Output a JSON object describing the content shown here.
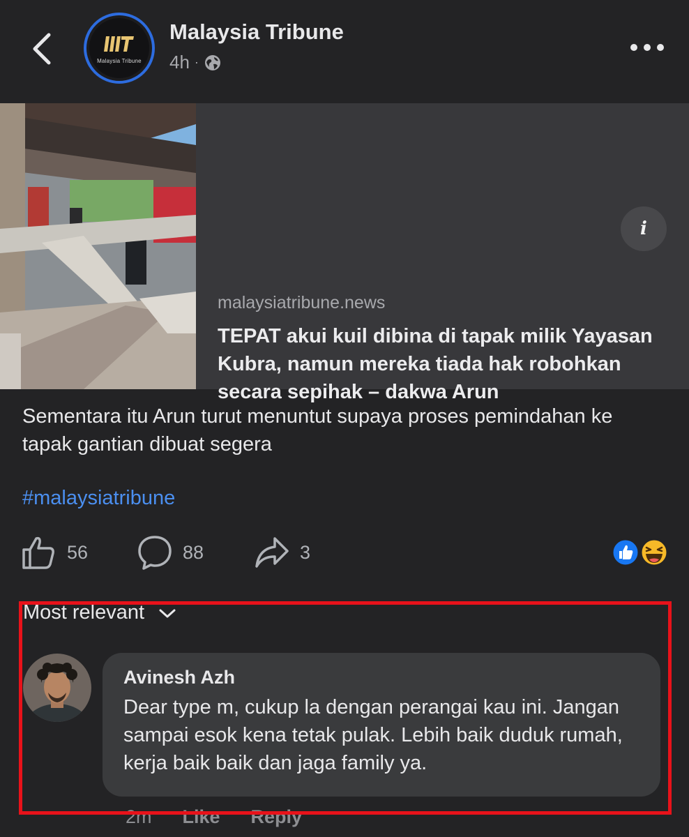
{
  "header": {
    "page_name": "Malaysia Tribune",
    "post_time": "4h",
    "separator": "·",
    "logo_caption": "Malaysia Tribune"
  },
  "link_card": {
    "domain": "malaysiatribune.news",
    "title": "TEPAT akui kuil dibina di tapak milik Yayasan Kubra, namun mereka tiada hak robohkan secara sepihak – dakwa Arun",
    "info_glyph": "i"
  },
  "post": {
    "text": "Sementara itu Arun turut menuntut supaya proses pemindahan ke tapak gantian dibuat segera",
    "hashtag": "#malaysiatribune"
  },
  "actions": {
    "likes": "56",
    "comments": "88",
    "shares": "3",
    "reaction_icons": [
      "like-reaction-icon",
      "haha-reaction-icon"
    ]
  },
  "comments": {
    "sort_label": "Most relevant",
    "items": [
      {
        "author": "Avinesh Azh",
        "text": "Dear type m, cukup la dengan perangai kau ini. Jangan sampai esok kena tetak pulak. Lebih baik duduk rumah, kerja baik baik dan jaga family ya.",
        "time": "2m",
        "like_label": "Like",
        "reply_label": "Reply"
      }
    ]
  },
  "colors": {
    "background": "#232325",
    "card": "#38383b",
    "accent_blue": "#2d6cdf",
    "hashtag": "#4b8ff0",
    "highlight_red": "#e8121a"
  }
}
